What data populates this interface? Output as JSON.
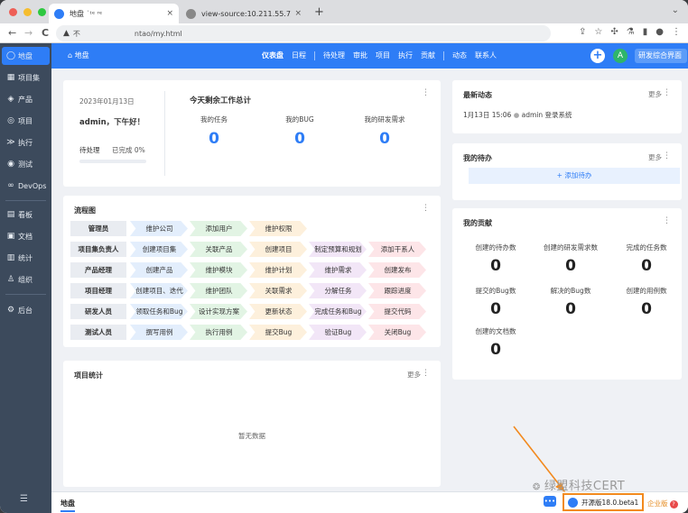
{
  "browser": {
    "tabs": [
      {
        "title": "地盘 ˙ᵗᵉ ʳᵉ",
        "close": "×"
      },
      {
        "title": "view-source:10.211.55.7/zent",
        "close": "×"
      }
    ],
    "new_tab": "+",
    "url_prefix": "不",
    "url_suffix": "ntao/my.html",
    "nav_back": "←",
    "nav_forward": "→",
    "nav_reload": "C"
  },
  "sidebar": {
    "items": [
      {
        "label": "地盘",
        "icon": "◯"
      },
      {
        "label": "项目集",
        "icon": "▦"
      },
      {
        "label": "产品",
        "icon": "◈"
      },
      {
        "label": "项目",
        "icon": "◎"
      },
      {
        "label": "执行",
        "icon": "≫"
      },
      {
        "label": "测试",
        "icon": "◉"
      },
      {
        "label": "DevOps",
        "icon": "∞"
      },
      {
        "label": "看板",
        "icon": "▤"
      },
      {
        "label": "文档",
        "icon": "▣"
      },
      {
        "label": "统计",
        "icon": "▥"
      },
      {
        "label": "组织",
        "icon": "♙"
      },
      {
        "label": "后台",
        "icon": "⚙"
      }
    ],
    "menu_icon": "☰"
  },
  "topbar": {
    "home": "地盘",
    "links": [
      "仪表盘",
      "日程",
      "待处理",
      "审批",
      "项目",
      "执行",
      "贡献",
      "动态",
      "联系人"
    ],
    "plus": "+",
    "avatar": "A",
    "right_label": "研发综合界面"
  },
  "welcome": {
    "date": "2023年01月13日",
    "greeting": "admin，下午好！",
    "pending_label": "待处理",
    "done_label": "已完成 0%",
    "progress": 0,
    "work_title": "今天剩余工作总计",
    "stats": [
      {
        "label": "我的任务",
        "value": "0"
      },
      {
        "label": "我的BUG",
        "value": "0"
      },
      {
        "label": "我的研发需求",
        "value": "0"
      }
    ]
  },
  "flow": {
    "title": "流程图",
    "rows": [
      {
        "role": "管理员",
        "steps": [
          "维护公司",
          "添加用户",
          "维护权限"
        ]
      },
      {
        "role": "项目集负责人",
        "steps": [
          "创建项目集",
          "关联产品",
          "创建项目",
          "制定预算和规划",
          "添加干系人"
        ]
      },
      {
        "role": "产品经理",
        "steps": [
          "创建产品",
          "维护模块",
          "维护计划",
          "维护需求",
          "创建发布"
        ]
      },
      {
        "role": "项目经理",
        "steps": [
          "创建项目、迭代",
          "维护团队",
          "关联需求",
          "分解任务",
          "跟踪进度"
        ]
      },
      {
        "role": "研发人员",
        "steps": [
          "领取任务和Bug",
          "设计实现方案",
          "更新状态",
          "完成任务和Bug",
          "提交代码"
        ]
      },
      {
        "role": "测试人员",
        "steps": [
          "撰写用例",
          "执行用例",
          "提交Bug",
          "验证Bug",
          "关闭Bug"
        ]
      }
    ],
    "step_colors": [
      "#e3eefc",
      "#e2f4e4",
      "#fdf0dc",
      "#f2e6f7",
      "#fde5e8",
      "#ebe6fb"
    ]
  },
  "project_stats": {
    "title": "项目统计",
    "more": "更多",
    "empty": "暂无数据"
  },
  "dynamics": {
    "title": "最新动态",
    "more": "更多",
    "entry_time": "1月13日 15:06",
    "entry_text": "admin  登录系统"
  },
  "todo": {
    "title": "我的待办",
    "more": "更多",
    "add": "+ 添加待办"
  },
  "contribution": {
    "title": "我的贡献",
    "items": [
      {
        "label": "创建的待办数",
        "value": "0"
      },
      {
        "label": "创建的研发需求数",
        "value": "0"
      },
      {
        "label": "完成的任务数",
        "value": "0"
      },
      {
        "label": "提交的Bug数",
        "value": "0"
      },
      {
        "label": "解决的Bug数",
        "value": "0"
      },
      {
        "label": "创建的用例数",
        "value": "0"
      },
      {
        "label": "创建的文档数",
        "value": "0"
      }
    ]
  },
  "footer": {
    "location": "地盘",
    "version": "开源版18.0.beta1",
    "enterprise": "企业版",
    "help": "?"
  },
  "watermark": "绿盟科技CERT",
  "colors": {
    "accent": "#2e7df6",
    "sidebar": "#3c4a5c",
    "highlight": "#f28a1e"
  }
}
